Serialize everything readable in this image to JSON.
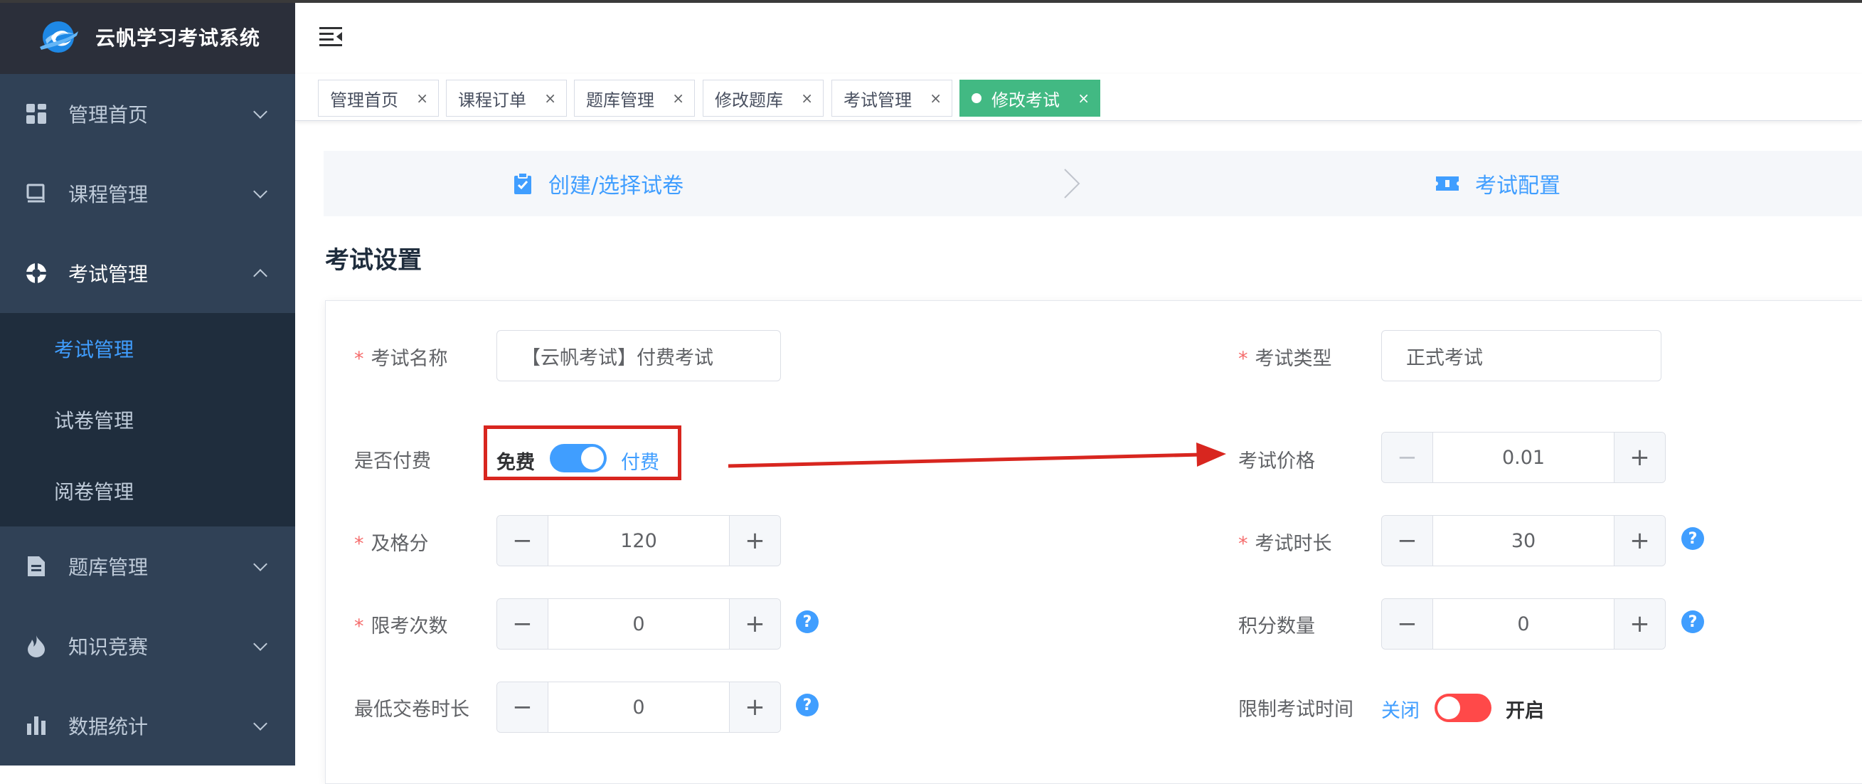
{
  "app": {
    "title": "云帆学习考试系统"
  },
  "sidebar": {
    "items": [
      {
        "label": "管理首页",
        "icon": "dashboard-icon",
        "expanded": false
      },
      {
        "label": "课程管理",
        "icon": "course-icon",
        "expanded": false
      },
      {
        "label": "考试管理",
        "icon": "exam-icon",
        "expanded": true,
        "children": [
          {
            "label": "考试管理",
            "active": true
          },
          {
            "label": "试卷管理",
            "active": false
          },
          {
            "label": "阅卷管理",
            "active": false
          }
        ]
      },
      {
        "label": "题库管理",
        "icon": "document-icon",
        "expanded": false
      },
      {
        "label": "知识竞赛",
        "icon": "fire-icon",
        "expanded": false
      },
      {
        "label": "数据统计",
        "icon": "bar-chart-icon",
        "expanded": false
      }
    ]
  },
  "tags": [
    {
      "label": "管理首页",
      "active": false
    },
    {
      "label": "课程订单",
      "active": false
    },
    {
      "label": "题库管理",
      "active": false
    },
    {
      "label": "修改题库",
      "active": false
    },
    {
      "label": "考试管理",
      "active": false
    },
    {
      "label": "修改考试",
      "active": true
    }
  ],
  "tag_close": "×",
  "steps": [
    {
      "label": "创建/选择试卷",
      "icon": "clipboard-check-icon"
    },
    {
      "label": "考试配置",
      "icon": "ticket-icon"
    }
  ],
  "section_title": "考试设置",
  "form": {
    "exam_name": {
      "label": "考试名称",
      "required": true,
      "value": "【云帆考试】付费考试"
    },
    "exam_type": {
      "label": "考试类型",
      "required": true,
      "value": "正式考试"
    },
    "is_paid": {
      "label": "是否付费",
      "off_text": "免费",
      "on_text": "付费",
      "value": true
    },
    "price": {
      "label": "考试价格",
      "value": "0.01",
      "minus_disabled": true
    },
    "pass_score": {
      "label": "及格分",
      "required": true,
      "value": "120"
    },
    "duration": {
      "label": "考试时长",
      "required": true,
      "value": "30"
    },
    "attempt_limit": {
      "label": "限考次数",
      "required": true,
      "value": "0"
    },
    "points": {
      "label": "积分数量",
      "value": "0"
    },
    "min_submit_time": {
      "label": "最低交卷时长",
      "value": "0"
    },
    "limit_time": {
      "label": "限制考试时间",
      "off_text": "关闭",
      "on_text": "开启",
      "value": false
    }
  },
  "controls": {
    "minus": "−",
    "plus": "+",
    "help": "?"
  },
  "colors": {
    "primary": "#409eff",
    "active_tag": "#42b983",
    "sidebar": "#304156",
    "danger": "#ff4949",
    "annotation": "#d8261f"
  }
}
